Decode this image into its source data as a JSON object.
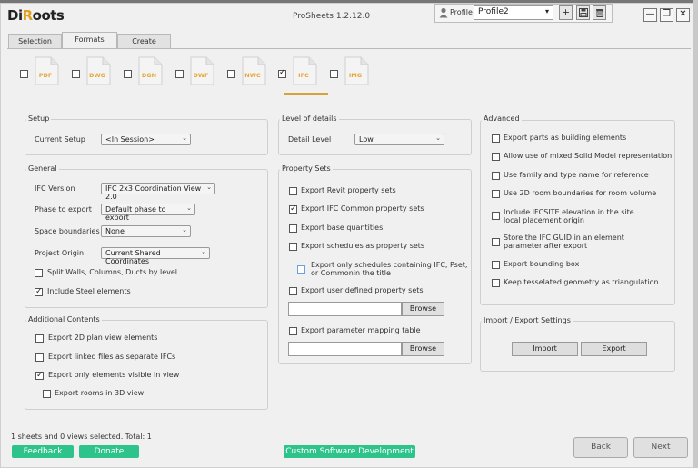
{
  "app": {
    "logo": "DiRoots",
    "title": "ProSheets 1.2.12.0"
  },
  "profile": {
    "label": "Profile",
    "value": "Profile2",
    "add_icon": "plus-icon",
    "save_icon": "floppy-icon",
    "delete_icon": "trash-icon"
  },
  "window_controls": {
    "minimize": "—",
    "restore": "❐",
    "close": "✕"
  },
  "tabs": [
    {
      "label": "Selection"
    },
    {
      "label": "Formats"
    },
    {
      "label": "Create"
    }
  ],
  "formats": [
    {
      "label": "PDF",
      "checked": false
    },
    {
      "label": "DWG",
      "checked": false
    },
    {
      "label": "DGN",
      "checked": false
    },
    {
      "label": "DWF",
      "checked": false
    },
    {
      "label": "NWC",
      "checked": false
    },
    {
      "label": "IFC",
      "checked": true
    },
    {
      "label": "IMG",
      "checked": false
    }
  ],
  "setup": {
    "title": "Setup",
    "current_setup_label": "Current Setup",
    "current_setup_value": "<In Session>"
  },
  "general": {
    "title": "General",
    "ifc_version_label": "IFC Version",
    "ifc_version_value": "IFC 2x3 Coordination View 2.0",
    "phase_label": "Phase to export",
    "phase_value": "Default phase to export",
    "space_label": "Space boundaries",
    "space_value": "None",
    "origin_label": "Project Origin",
    "origin_value": "Current Shared Coordinates",
    "split_walls": "Split Walls, Columns, Ducts by level",
    "include_steel": "Include Steel elements"
  },
  "additional": {
    "title": "Additional Contents",
    "items": [
      "Export 2D plan view elements",
      "Export linked files as separate IFCs",
      "Export only elements visible in view",
      "Export rooms in 3D view"
    ]
  },
  "level_of_details": {
    "title": "Level of details",
    "detail_label": "Detail Level",
    "detail_value": "Low"
  },
  "property_sets": {
    "title": "Property Sets",
    "items": [
      "Export Revit property sets",
      "Export IFC Common property sets",
      "Export base quantities",
      "Export schedules as property sets"
    ],
    "schedules_only_line1": "Export only schedules containing IFC, Pset,",
    "schedules_only_line2": "or Commonin the title",
    "user_defined": "Export user defined property sets",
    "browse": "Browse",
    "param_mapping": "Export parameter mapping table",
    "browse2": "Browse"
  },
  "advanced": {
    "title": "Advanced",
    "items": [
      "Export parts as building elements",
      "Allow use of mixed Solid Model representation",
      "Use family and type name for reference",
      "Use 2D room boundaries for room volume"
    ],
    "ifcsite_line1": "Include IFCSITE elevation in the site",
    "ifcsite_line2": "local placement origin",
    "guid_line1": "Store the IFC GUID in an element",
    "guid_line2": "parameter after export",
    "bounding_box": "Export bounding box",
    "tessellated": "Keep tesselated geometry as triangulation"
  },
  "import_export": {
    "title": "Import / Export Settings",
    "import": "Import",
    "export": "Export"
  },
  "status": "1 sheets and 0 views selected. Total: 1",
  "footer": {
    "feedback": "Feedback",
    "donate": "Donate",
    "custom": "Custom Software Development",
    "back": "Back",
    "next": "Next"
  },
  "colors": {
    "accent_green": "#2dc38a",
    "format_orange": "#e6a73a"
  }
}
